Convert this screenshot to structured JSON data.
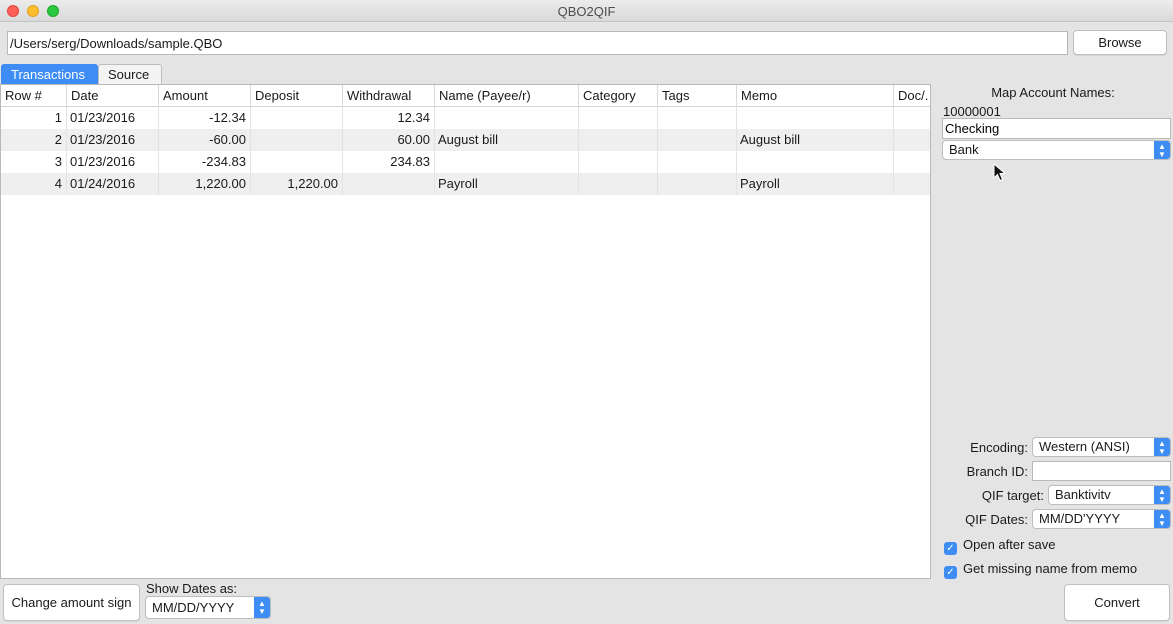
{
  "window": {
    "title": "QBO2QIF"
  },
  "path": {
    "value": "/Users/serg/Downloads/sample.QBO",
    "browse_label": "Browse"
  },
  "tabs": [
    {
      "label": "Transactions",
      "active": true
    },
    {
      "label": "Source",
      "active": false
    }
  ],
  "table": {
    "columns": [
      "Row #",
      "Date",
      "Amount",
      "Deposit",
      "Withdrawal",
      "Name (Payee/r)",
      "Category",
      "Tags",
      "Memo",
      "Doc/."
    ],
    "rows": [
      {
        "row": "1",
        "date": "01/23/2016",
        "amount": "-12.34",
        "deposit": "",
        "withdrawal": "12.34",
        "name": "",
        "category": "",
        "tags": "",
        "memo": "",
        "doc": ""
      },
      {
        "row": "2",
        "date": "01/23/2016",
        "amount": "-60.00",
        "deposit": "",
        "withdrawal": "60.00",
        "name": "August bill",
        "category": "",
        "tags": "",
        "memo": "August bill",
        "doc": ""
      },
      {
        "row": "3",
        "date": "01/23/2016",
        "amount": "-234.83",
        "deposit": "",
        "withdrawal": "234.83",
        "name": "",
        "category": "",
        "tags": "",
        "memo": "",
        "doc": ""
      },
      {
        "row": "4",
        "date": "01/24/2016",
        "amount": "1,220.00",
        "deposit": "1,220.00",
        "withdrawal": "",
        "name": "Payroll",
        "category": "",
        "tags": "",
        "memo": "Payroll",
        "doc": ""
      }
    ]
  },
  "map": {
    "title": "Map Account Names:",
    "account_id": "10000001",
    "account_name": "Checking",
    "account_type": "Bank"
  },
  "options": {
    "encoding_label": "Encoding:",
    "encoding_value": "Western (ANSI)",
    "branch_label": "Branch ID:",
    "branch_value": "",
    "target_label": "QIF target:",
    "target_value": "Banktivitv",
    "dates_label": "QIF Dates:",
    "dates_value": "MM/DD'YYYY",
    "open_after_save": "Open after save",
    "get_missing_name": "Get missing name from memo"
  },
  "bottom": {
    "change_sign": "Change amount sign",
    "show_dates_label": "Show Dates as:",
    "show_dates_value": "MM/DD/YYYY",
    "convert": "Convert"
  },
  "colors": {
    "accent": "#3d8df5",
    "alt_row": "#efefef"
  }
}
